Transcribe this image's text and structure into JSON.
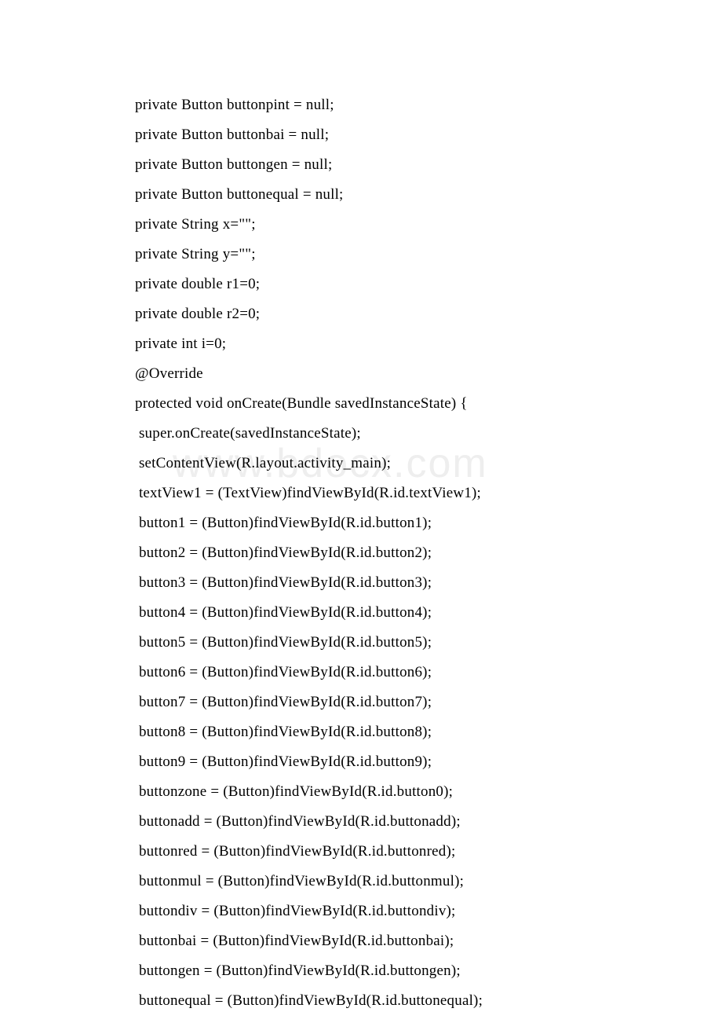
{
  "watermark": "www.bdocx.com",
  "lines": [
    "private Button buttonpint = null;",
    "private Button buttonbai = null;",
    "private Button buttongen = null;",
    "private Button buttonequal = null;",
    "private String x=\"\";",
    "private String y=\"\";",
    "private double r1=0;",
    "private double r2=0;",
    "private int i=0;",
    "@Override",
    "protected void onCreate(Bundle savedInstanceState) {",
    " super.onCreate(savedInstanceState);",
    " setContentView(R.layout.activity_main);",
    " textView1 = (TextView)findViewById(R.id.textView1);",
    " button1 = (Button)findViewById(R.id.button1);",
    " button2 = (Button)findViewById(R.id.button2);",
    " button3 = (Button)findViewById(R.id.button3);",
    " button4 = (Button)findViewById(R.id.button4);",
    " button5 = (Button)findViewById(R.id.button5);",
    " button6 = (Button)findViewById(R.id.button6);",
    " button7 = (Button)findViewById(R.id.button7);",
    " button8 = (Button)findViewById(R.id.button8);",
    " button9 = (Button)findViewById(R.id.button9);",
    " buttonzone = (Button)findViewById(R.id.button0);",
    " buttonadd = (Button)findViewById(R.id.buttonadd);",
    " buttonred = (Button)findViewById(R.id.buttonred);",
    " buttonmul = (Button)findViewById(R.id.buttonmul);",
    " buttondiv = (Button)findViewById(R.id.buttondiv);",
    " buttonbai = (Button)findViewById(R.id.buttonbai);",
    " buttongen = (Button)findViewById(R.id.buttongen);",
    " buttonequal = (Button)findViewById(R.id.buttonequal);"
  ]
}
